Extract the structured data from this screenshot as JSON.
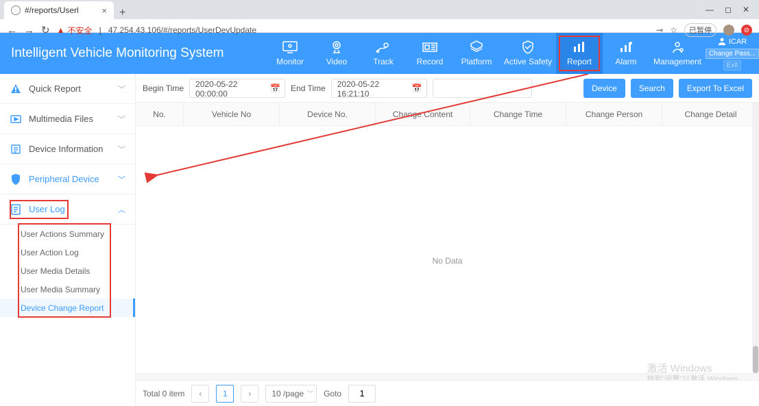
{
  "browser": {
    "tab_title": "#/reports/Userl",
    "new_tab": "+",
    "insecure_label": "不安全",
    "url": "47.254.43.106/#/reports/UserDevUpdate",
    "paused": "已暂停",
    "key_icon_title": "key"
  },
  "app": {
    "title": "Intelligent Vehicle Monitoring System"
  },
  "nav": {
    "monitor": "Monitor",
    "video": "Video",
    "track": "Track",
    "record": "Record",
    "platform": "Platform",
    "active_safety": "Active Safety",
    "report": "Report",
    "alarm": "Alarm",
    "management": "Management"
  },
  "user": {
    "name": "ICAR",
    "change_pass": "Change Pass...",
    "exit": "Exit"
  },
  "sidebar": {
    "quick_report": "Quick Report",
    "multimedia": "Multimedia Files",
    "device_info": "Device Information",
    "peripheral": "Peripheral Device",
    "user_log": "User Log",
    "subs": {
      "actions_summary": "User Actions Summary",
      "action_log": "User Action Log",
      "media_details": "User Media Details",
      "media_summary": "User Media Summary",
      "device_change": "Device Change Report"
    }
  },
  "toolbar": {
    "begin_time_label": "Begin Time",
    "begin_time_value": "2020-05-22 00:00:00",
    "end_time_label": "End Time",
    "end_time_value": "2020-05-22 16:21:10",
    "device_btn": "Device",
    "search_btn": "Search",
    "export_btn": "Export To Excel"
  },
  "table": {
    "cols": {
      "no": "No.",
      "vehicle": "Vehicle No",
      "device": "Device No.",
      "content": "Change Content",
      "time": "Change Time",
      "person": "Change Person",
      "detail": "Change Detail"
    },
    "no_data": "No Data"
  },
  "pager": {
    "total": "Total 0 item",
    "current": "1",
    "per_page": "10 /page",
    "goto": "Goto",
    "goto_val": "1"
  },
  "watermark": {
    "line1": "激活 Windows",
    "line2": "转到\"设置\"以激活 Windows。"
  }
}
